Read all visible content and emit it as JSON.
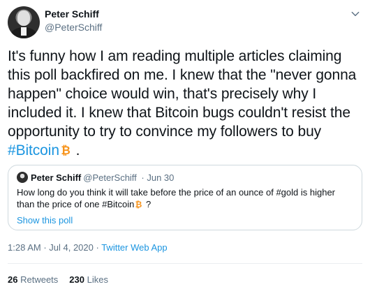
{
  "author": {
    "display_name": "Peter Schiff",
    "handle": "@PeterSchiff"
  },
  "tweet": {
    "text_main": "It's funny how I am reading multiple articles claiming this poll backfired on me. I knew that the \"never gonna happen\" choice would win, that's precisely why I included it. I knew that Bitcoin bugs couldn't resist the opportunity to try to convince my followers to buy ",
    "hashtag": "#Bitcoin",
    "text_end": " ."
  },
  "quoted": {
    "display_name": "Peter Schiff",
    "handle": "@PeterSchiff",
    "date": "Jun 30",
    "text_before": "How long do you think it will take before the price of an ounce of #gold is higher than the price of one #Bitcoin",
    "text_after": " ?",
    "poll_link": "Show this poll"
  },
  "meta": {
    "time": "1:28 AM",
    "date": "Jul 4, 2020",
    "app": "Twitter Web App"
  },
  "stats": {
    "retweets_count": "26",
    "retweets_label": "Retweets",
    "likes_count": "230",
    "likes_label": "Likes"
  },
  "icons": {
    "bitcoin": "bitcoin-emoji-icon",
    "more": "chevron-down-icon"
  },
  "colors": {
    "link": "#1b95e0",
    "secondary_text": "#5b7083",
    "bitcoin_orange": "#f7931a"
  }
}
